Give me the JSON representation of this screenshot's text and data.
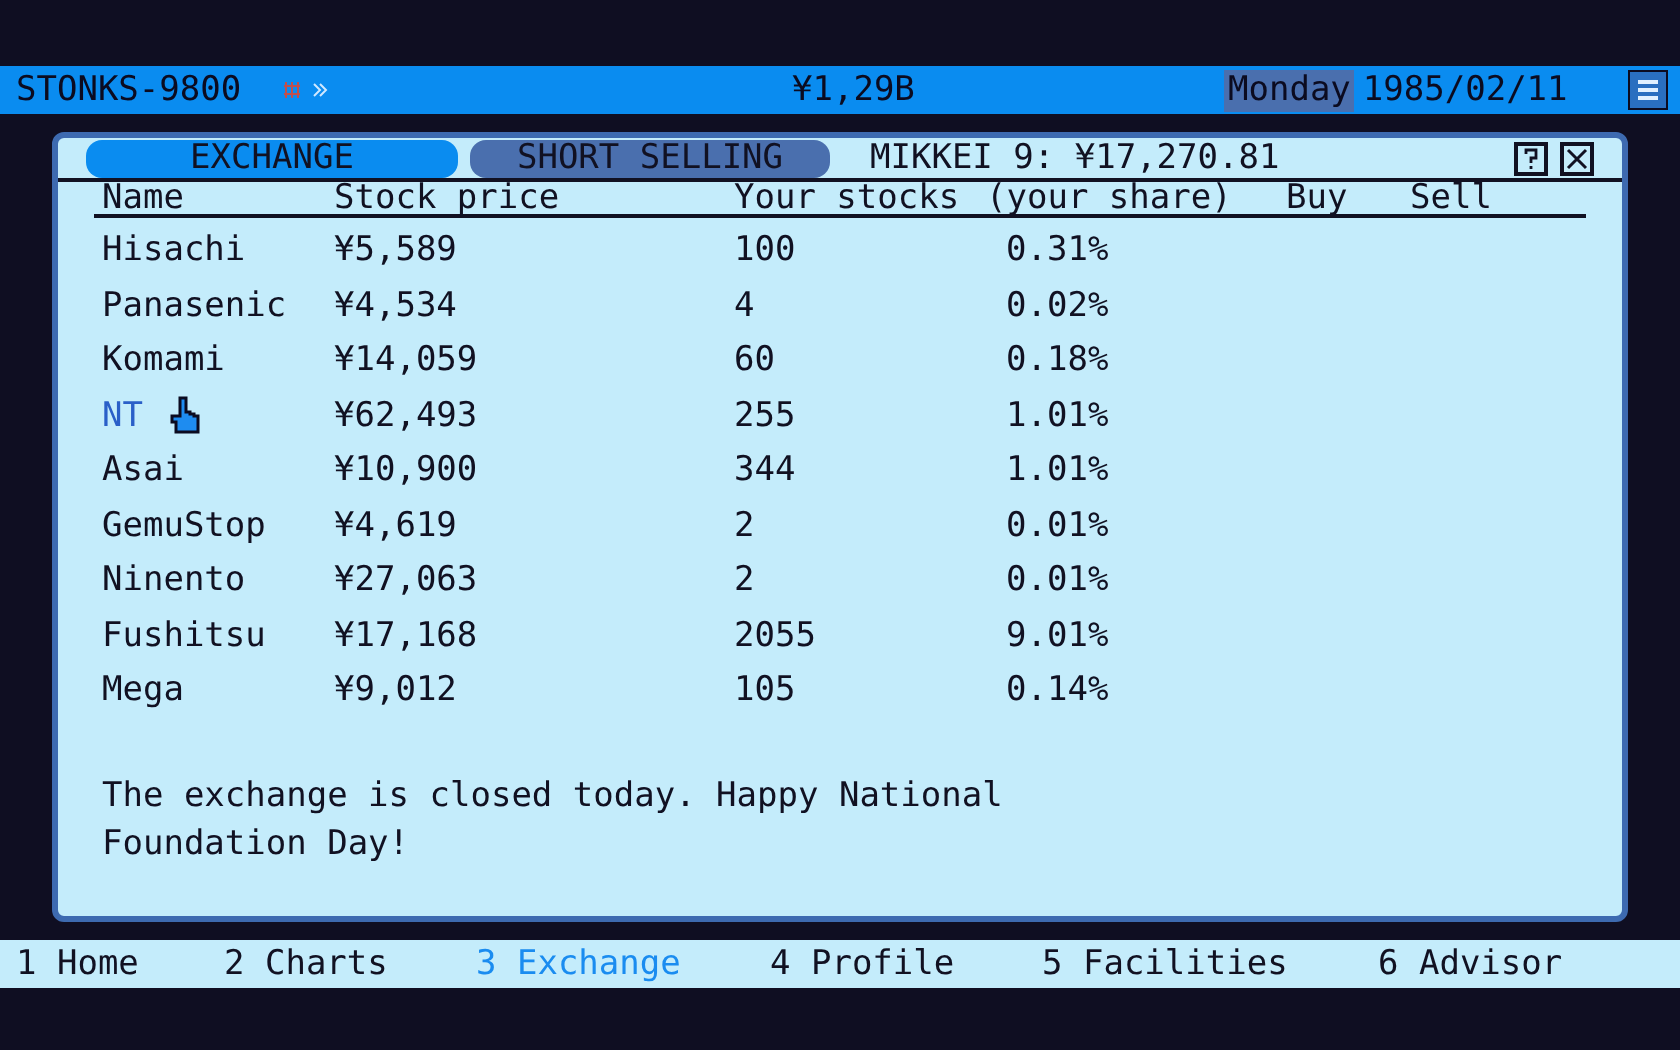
{
  "top_bar": {
    "title": "STONKS-9800",
    "money": "¥1,29B",
    "day": "Monday",
    "date": "1985/02/11"
  },
  "window": {
    "tabs": [
      {
        "label": "EXCHANGE",
        "selected": true
      },
      {
        "label": "SHORT SELLING",
        "selected": false
      }
    ],
    "index": "MIKKEI 9: ¥17,270.81",
    "table": {
      "columns": [
        "Name",
        "Stock price",
        "Your stocks",
        "(your share)",
        "Buy",
        "Sell"
      ],
      "rows": [
        {
          "name": "Hisachi",
          "price": "¥5,589",
          "stocks": "100",
          "share": "0.31%",
          "selected": false
        },
        {
          "name": "Panasenic",
          "price": "¥4,534",
          "stocks": "4",
          "share": "0.02%",
          "selected": false
        },
        {
          "name": "Komami",
          "price": "¥14,059",
          "stocks": "60",
          "share": "0.18%",
          "selected": false
        },
        {
          "name": "NT",
          "price": "¥62,493",
          "stocks": "255",
          "share": "1.01%",
          "selected": true
        },
        {
          "name": "Asai",
          "price": "¥10,900",
          "stocks": "344",
          "share": "1.01%",
          "selected": false
        },
        {
          "name": "GemuStop",
          "price": "¥4,619",
          "stocks": "2",
          "share": "0.01%",
          "selected": false
        },
        {
          "name": "Ninento",
          "price": "¥27,063",
          "stocks": "2",
          "share": "0.01%",
          "selected": false
        },
        {
          "name": "Fushitsu",
          "price": "¥17,168",
          "stocks": "2055",
          "share": "9.01%",
          "selected": false
        },
        {
          "name": "Mega",
          "price": "¥9,012",
          "stocks": "105",
          "share": "0.14%",
          "selected": false
        }
      ]
    },
    "message": "The exchange is closed today. Happy National Foundation Day!"
  },
  "nav": [
    {
      "label": "1 Home",
      "selected": false
    },
    {
      "label": "2 Charts",
      "selected": false
    },
    {
      "label": "3 Exchange",
      "selected": true
    },
    {
      "label": "4 Profile",
      "selected": false
    },
    {
      "label": "5 Facilities",
      "selected": false
    },
    {
      "label": "6 Advisor",
      "selected": false
    }
  ]
}
